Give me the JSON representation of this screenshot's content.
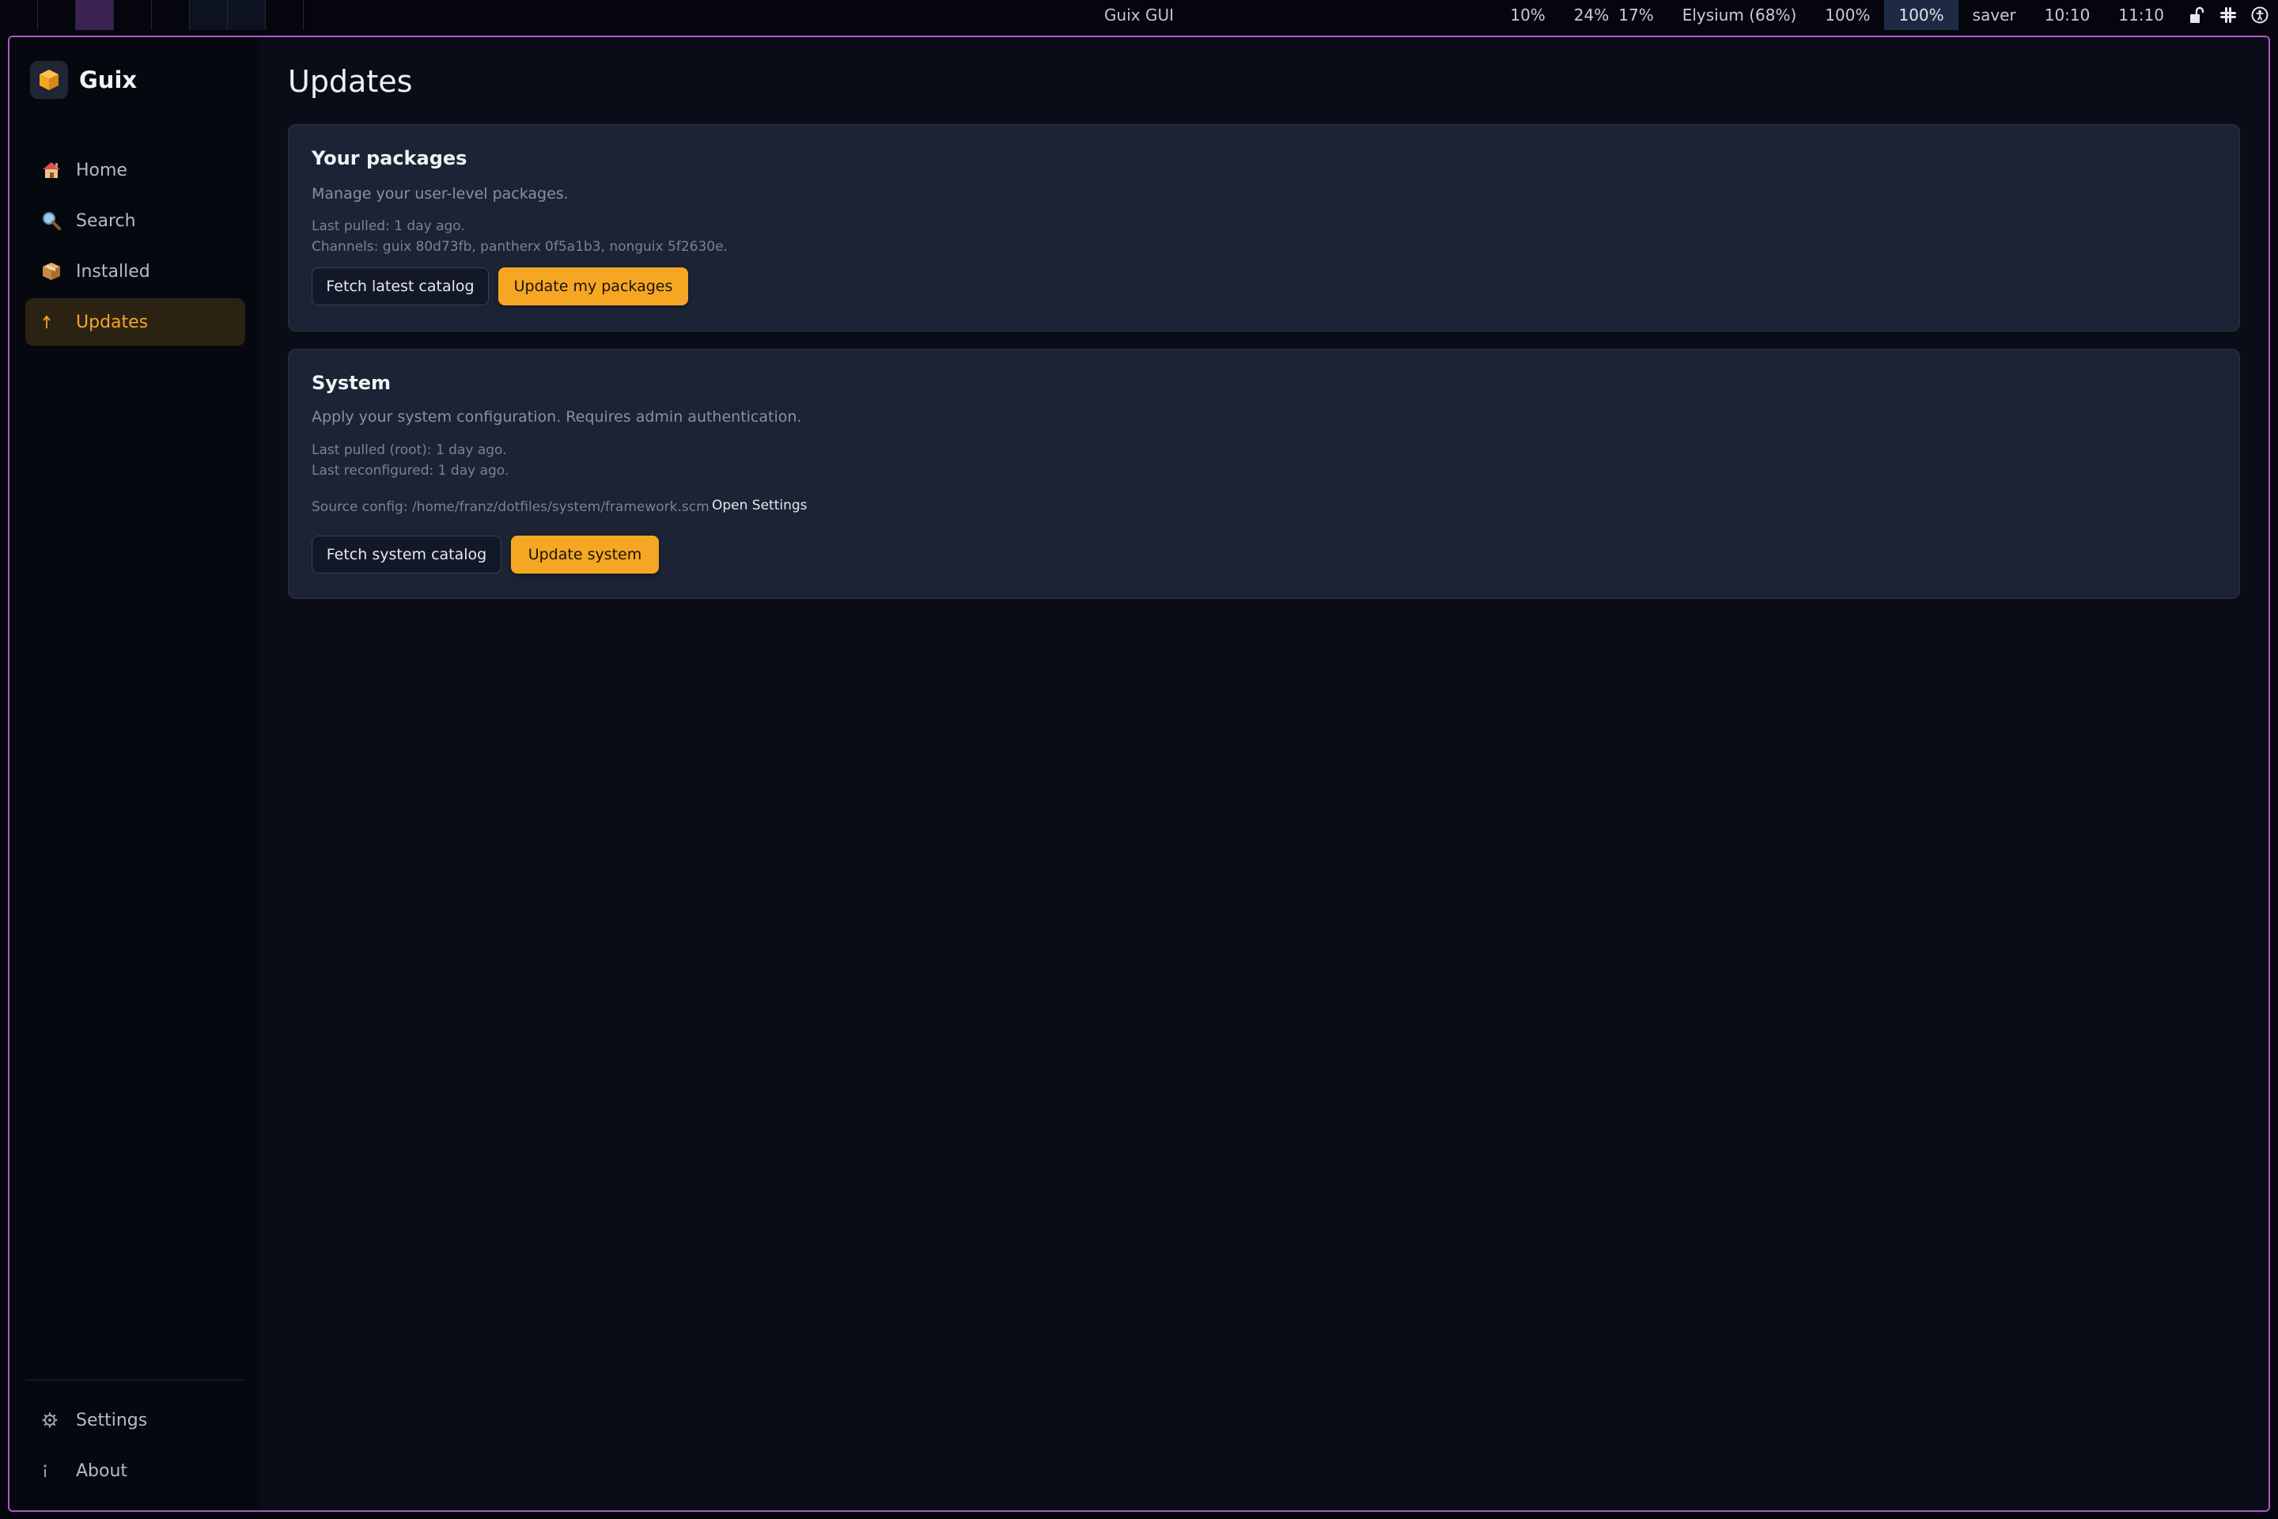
{
  "topbar": {
    "title": "Guix GUI",
    "indicators": [
      "10%",
      "24%",
      "17%",
      "Elysium (68%)",
      "100%",
      "100%",
      "saver",
      "10:10",
      "11:10"
    ],
    "tray_icons": [
      "unlock-icon",
      "slack-icon",
      "accessibility-icon"
    ]
  },
  "app": {
    "name": "Guix",
    "logo_icon": "package-cube-icon",
    "accent_color": "#f5a623"
  },
  "sidebar": {
    "items": [
      {
        "label": "Home",
        "icon": "home-icon"
      },
      {
        "label": "Search",
        "icon": "search-icon"
      },
      {
        "label": "Installed",
        "icon": "package-icon"
      },
      {
        "label": "Updates",
        "icon": "arrow-up-icon",
        "active": true
      }
    ],
    "bottom_items": [
      {
        "label": "Settings",
        "icon": "gear-icon"
      },
      {
        "label": "About",
        "icon": "info-icon"
      }
    ]
  },
  "main": {
    "title": "Updates",
    "packages_card": {
      "title": "Your packages",
      "description": "Manage your user-level packages.",
      "last_pulled": "Last pulled: 1 day ago.",
      "channels": "Channels: guix 80d73fb, pantherx 0f5a1b3, nonguix 5f2630e.",
      "fetch_label": "Fetch latest catalog",
      "update_label": "Update my packages"
    },
    "system_card": {
      "title": "System",
      "description": "Apply your system configuration. Requires admin authentication.",
      "last_pulled": "Last pulled (root): 1 day ago.",
      "last_reconfigured": "Last reconfigured: 1 day ago.",
      "source_config": "Source config: /home/franz/dotfiles/system/framework.scm",
      "open_settings_label": "Open Settings",
      "fetch_label": "Fetch system catalog",
      "update_label": "Update system"
    }
  }
}
